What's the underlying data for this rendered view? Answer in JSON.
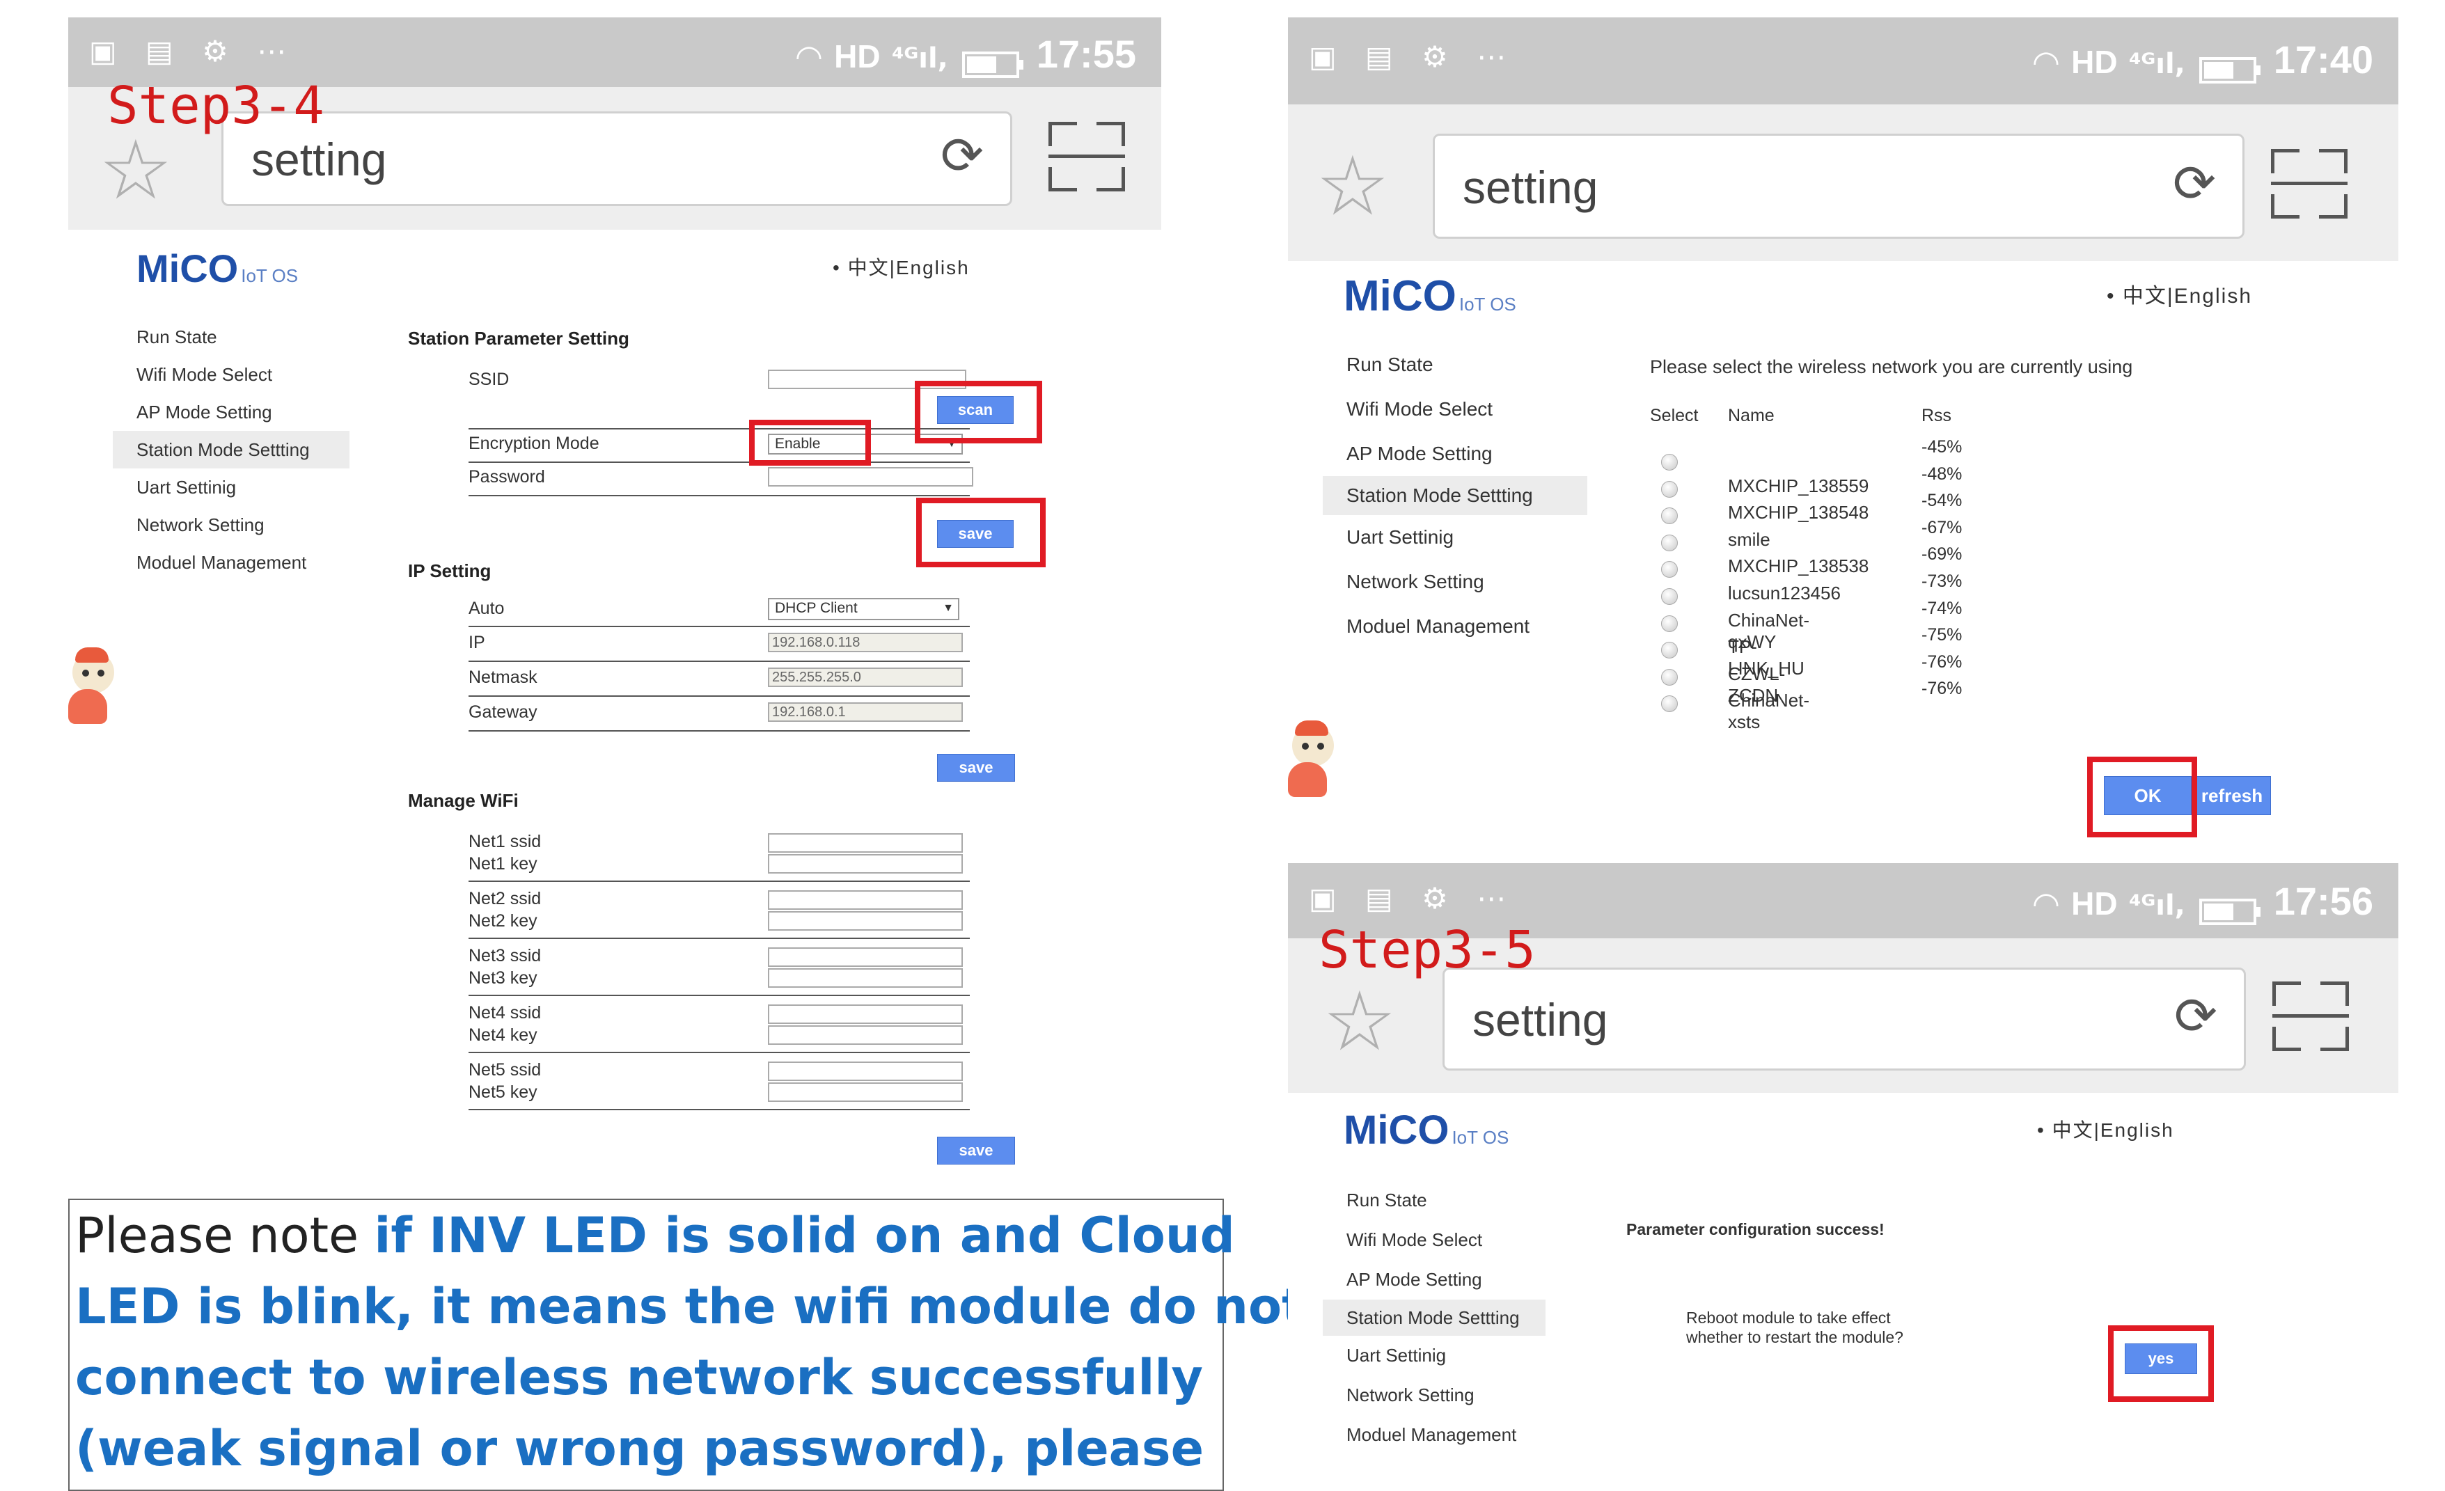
{
  "colors": {
    "accent_blue": "#5c8def",
    "highlight_red": "#e01b24",
    "step_red": "#d21b1b",
    "note_blue": "#1a6fc2"
  },
  "common": {
    "url_text": "setting",
    "logo": "MiCO",
    "logo_sub": "IoT OS",
    "lang_label": "• 中文|English",
    "nav": [
      "Run State",
      "Wifi Mode Select",
      "AP Mode Setting",
      "Station Mode Settting",
      "Uart Settinig",
      "Network Setting",
      "Moduel Management"
    ],
    "hd": "HD",
    "signal": "⁴ᴳıl,"
  },
  "step4": {
    "time": "17:55",
    "step_label": "Step3-4",
    "station_title": "Station Parameter Setting",
    "ssid_label": "SSID",
    "scan_btn": "scan",
    "encryption_label": "Encryption Mode",
    "encryption_value": "Enable",
    "password_label": "Password",
    "save_btn": "save",
    "ip_title": "IP Setting",
    "ip_rows": [
      {
        "label": "Auto",
        "value": "DHCP Client"
      },
      {
        "label": "IP",
        "value": "192.168.0.118"
      },
      {
        "label": "Netmask",
        "value": "255.255.255.0"
      },
      {
        "label": "Gateway",
        "value": "192.168.0.1"
      }
    ],
    "manage_title": "Manage WiFi",
    "nets": [
      {
        "ssid": "Net1 ssid",
        "key": "Net1 key"
      },
      {
        "ssid": "Net2 ssid",
        "key": "Net2 key"
      },
      {
        "ssid": "Net3 ssid",
        "key": "Net3 key"
      },
      {
        "ssid": "Net4 ssid",
        "key": "Net4 key"
      },
      {
        "ssid": "Net5 ssid",
        "key": "Net5 key"
      }
    ]
  },
  "scanlist": {
    "time": "17:40",
    "prompt": "Please select the wireless network you are currently using",
    "headers": {
      "select": "Select",
      "name": "Name",
      "rss": "Rss"
    },
    "networks": [
      {
        "name": "",
        "rss": "-45%"
      },
      {
        "name": "MXCHIP_138559",
        "rss": "-48%"
      },
      {
        "name": "MXCHIP_138548",
        "rss": "-54%"
      },
      {
        "name": "smile",
        "rss": "-67%"
      },
      {
        "name": "MXCHIP_138538",
        "rss": "-69%"
      },
      {
        "name": "lucsun123456",
        "rss": "-73%"
      },
      {
        "name": "ChinaNet-qxWY",
        "rss": "-74%"
      },
      {
        "name": "TP-LINK_HU",
        "rss": "-75%"
      },
      {
        "name": "CZWL-ZCDN",
        "rss": "-76%"
      },
      {
        "name": "ChinaNet-xsts",
        "rss": "-76%"
      }
    ],
    "ok_btn": "OK",
    "refresh_btn": "refresh"
  },
  "step5": {
    "time": "17:56",
    "step_label": "Step3-5",
    "success": "Parameter configuration success!",
    "reboot_line1": "Reboot module to take effect",
    "reboot_line2": "whether to restart the module?",
    "yes_btn": "yes"
  },
  "note": {
    "lead": "Please note ",
    "line1": "if INV LED is solid on and Cloud",
    "line2": "LED is blink, it means the wifi module do not",
    "line3": "connect to wireless network successfully",
    "line4": "(weak signal or wrong password), please"
  }
}
